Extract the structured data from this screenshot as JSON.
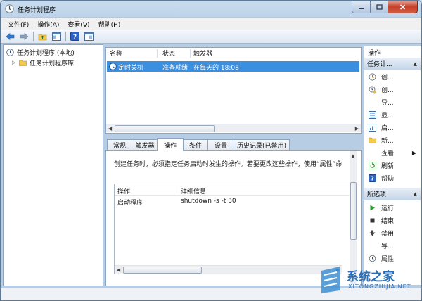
{
  "window": {
    "title": "任务计划程序"
  },
  "menu": [
    "文件(F)",
    "操作(A)",
    "查看(V)",
    "帮助(H)"
  ],
  "tree": {
    "root": "任务计划程序 (本地)",
    "child": "任务计划程序库"
  },
  "task_list": {
    "columns": [
      "名称",
      "状态",
      "触发器"
    ],
    "rows": [
      {
        "name": "定时关机",
        "status": "准备就绪",
        "trigger": "在每天的 18:08"
      }
    ]
  },
  "tabs": [
    "常规",
    "触发器",
    "操作",
    "条件",
    "设置",
    "历史记录(已禁用)"
  ],
  "active_tab": "操作",
  "details": {
    "description": "创建任务时，必须指定任务启动时发生的操作。若要更改这些操作，使用“属性”命",
    "columns": [
      "操作",
      "详细信息"
    ],
    "rows": [
      {
        "action": "启动程序",
        "detail": "shutdown -s -t 30"
      }
    ]
  },
  "actions_pane": {
    "title": "操作",
    "section1": {
      "title": "任务计...",
      "items": [
        {
          "label": "创...",
          "icon": "create-basic-task-icon"
        },
        {
          "label": "创...",
          "icon": "create-task-icon"
        },
        {
          "label": "导...",
          "icon": ""
        },
        {
          "label": "显...",
          "icon": "display-tasks-icon"
        },
        {
          "label": "启...",
          "icon": "enable-history-icon"
        },
        {
          "label": "新...",
          "icon": "new-folder-icon"
        },
        {
          "label": "查看",
          "icon": ""
        },
        {
          "label": "刷新",
          "icon": "refresh-icon"
        },
        {
          "label": "帮助",
          "icon": "help-icon"
        }
      ]
    },
    "section2": {
      "title": "所选项",
      "items": [
        {
          "label": "运行",
          "icon": "run-icon"
        },
        {
          "label": "结束",
          "icon": "end-icon"
        },
        {
          "label": "禁用",
          "icon": "disable-icon"
        },
        {
          "label": "导...",
          "icon": ""
        },
        {
          "label": "属性",
          "icon": "properties-icon"
        }
      ]
    }
  },
  "watermark": {
    "brand": "系统之家",
    "url": "XITONGZHIJIA.NET"
  }
}
